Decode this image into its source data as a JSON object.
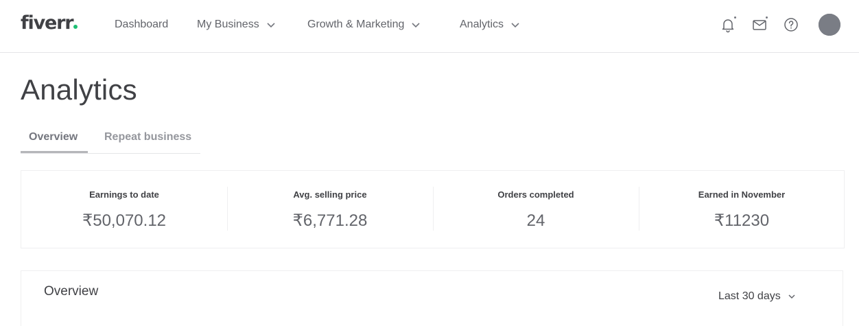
{
  "header": {
    "logo_text": "fiverr",
    "brand_dot_color": "#1dbf73",
    "nav": [
      {
        "label": "Dashboard",
        "has_dropdown": false
      },
      {
        "label": "My Business",
        "has_dropdown": true
      },
      {
        "label": "Growth & Marketing",
        "has_dropdown": true
      },
      {
        "label": "Analytics",
        "has_dropdown": true
      }
    ],
    "icons": [
      "bell-icon",
      "mail-icon",
      "help-icon"
    ]
  },
  "page": {
    "title": "Analytics"
  },
  "tabs": [
    {
      "label": "Overview",
      "active": true
    },
    {
      "label": "Repeat business",
      "active": false
    }
  ],
  "stats": [
    {
      "label": "Earnings to date",
      "value": "₹50,070.12"
    },
    {
      "label": "Avg. selling price",
      "value": "₹6,771.28"
    },
    {
      "label": "Orders completed",
      "value": "24"
    },
    {
      "label": "Earned in November",
      "value": "₹11230"
    }
  ],
  "overview": {
    "title": "Overview",
    "range_selected": "Last 30 days"
  }
}
